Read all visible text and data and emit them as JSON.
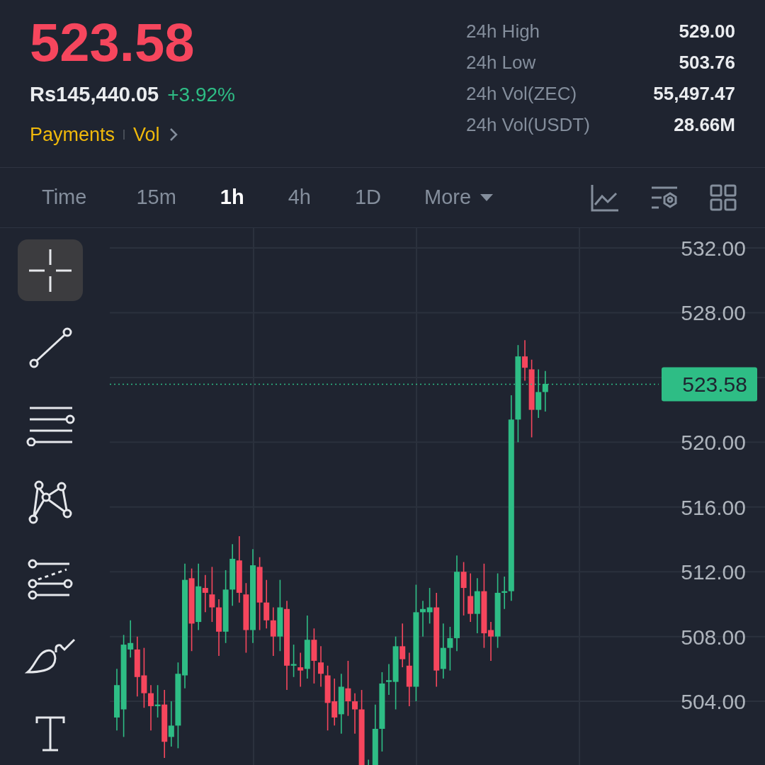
{
  "header": {
    "price": "523.58",
    "fiat_price": "Rs145,440.05",
    "change": "+3.92%",
    "links": [
      "Payments",
      "Vol"
    ]
  },
  "stats": [
    {
      "label": "24h High",
      "value": "529.00"
    },
    {
      "label": "24h Low",
      "value": "503.76"
    },
    {
      "label": "24h Vol(ZEC)",
      "value": "55,497.47"
    },
    {
      "label": "24h Vol(USDT)",
      "value": "28.66M"
    }
  ],
  "intervals": [
    {
      "label": "Time",
      "selected": false
    },
    {
      "label": "15m",
      "selected": false
    },
    {
      "label": "1h",
      "selected": true
    },
    {
      "label": "4h",
      "selected": false
    },
    {
      "label": "1D",
      "selected": false
    }
  ],
  "more": {
    "label": "More"
  },
  "tools": [
    {
      "kind": "crosshair",
      "selected": true
    },
    {
      "kind": "trendline",
      "selected": false
    },
    {
      "kind": "hlines",
      "selected": false
    },
    {
      "kind": "pattern",
      "selected": false
    },
    {
      "kind": "fib",
      "selected": false
    },
    {
      "kind": "brush",
      "selected": false
    },
    {
      "kind": "text",
      "selected": false
    }
  ],
  "chart": {
    "price_ticks": [
      "532.00",
      "528.00",
      "520.00",
      "516.00",
      "512.00",
      "508.00",
      "504.00"
    ],
    "current_price": "523.58"
  }
}
